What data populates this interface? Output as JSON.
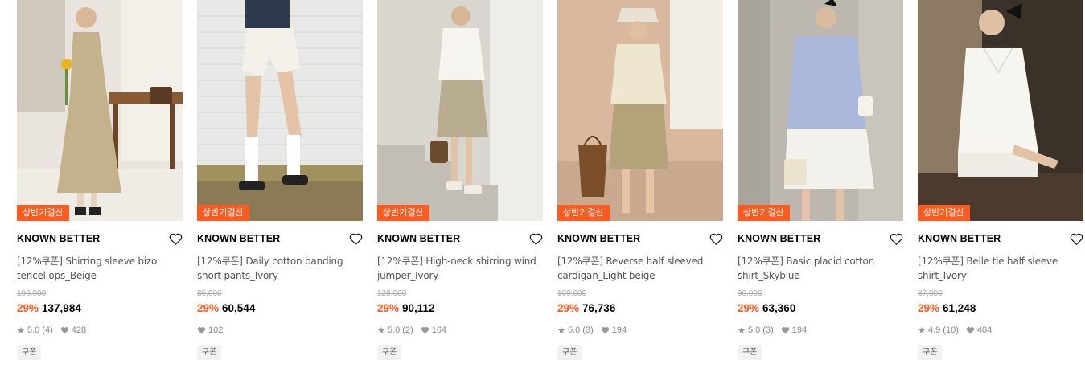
{
  "products": [
    {
      "badge": "상반기결산",
      "brand": "KNOWN BETTER",
      "name": "[12%쿠폰] Shirring sleeve bizo tencel ops_Beige",
      "original_price": "196,000",
      "discount": "29%",
      "price": "137,984",
      "rating": "5.0",
      "review_count": "(4)",
      "likes": "428",
      "coupon": "쿠폰",
      "has_rating": true
    },
    {
      "badge": "상반기결산",
      "brand": "KNOWN BETTER",
      "name": "[12%쿠폰] Daily cotton banding short pants_Ivory",
      "original_price": "86,000",
      "discount": "29%",
      "price": "60,544",
      "rating": "",
      "review_count": "",
      "likes": "102",
      "coupon": "쿠폰",
      "has_rating": false
    },
    {
      "badge": "상반기결산",
      "brand": "KNOWN BETTER",
      "name": "[12%쿠폰] High-neck shirring wind jumper_Ivory",
      "original_price": "128,000",
      "discount": "29%",
      "price": "90,112",
      "rating": "5.0",
      "review_count": "(2)",
      "likes": "164",
      "coupon": "쿠폰",
      "has_rating": true
    },
    {
      "badge": "상반기결산",
      "brand": "KNOWN BETTER",
      "name": "[12%쿠폰] Reverse half sleeved cardigan_Light beige",
      "original_price": "109,000",
      "discount": "29%",
      "price": "76,736",
      "rating": "5.0",
      "review_count": "(3)",
      "likes": "194",
      "coupon": "쿠폰",
      "has_rating": true
    },
    {
      "badge": "상반기결산",
      "brand": "KNOWN BETTER",
      "name": "[12%쿠폰] Basic placid cotton shirt_Skyblue",
      "original_price": "90,000",
      "discount": "29%",
      "price": "63,360",
      "rating": "5.0",
      "review_count": "(3)",
      "likes": "194",
      "coupon": "쿠폰",
      "has_rating": true
    },
    {
      "badge": "상반기결산",
      "brand": "KNOWN BETTER",
      "name": "[12%쿠폰] Belle tie half sleeve shirt_Ivory",
      "original_price": "87,000",
      "discount": "29%",
      "price": "61,248",
      "rating": "4.9",
      "review_count": "(10)",
      "likes": "404",
      "coupon": "쿠폰",
      "has_rating": true
    }
  ],
  "colors": {
    "accent": "#ff5a1f",
    "meta_text": "#888888",
    "strike_text": "#aaaaaa"
  }
}
